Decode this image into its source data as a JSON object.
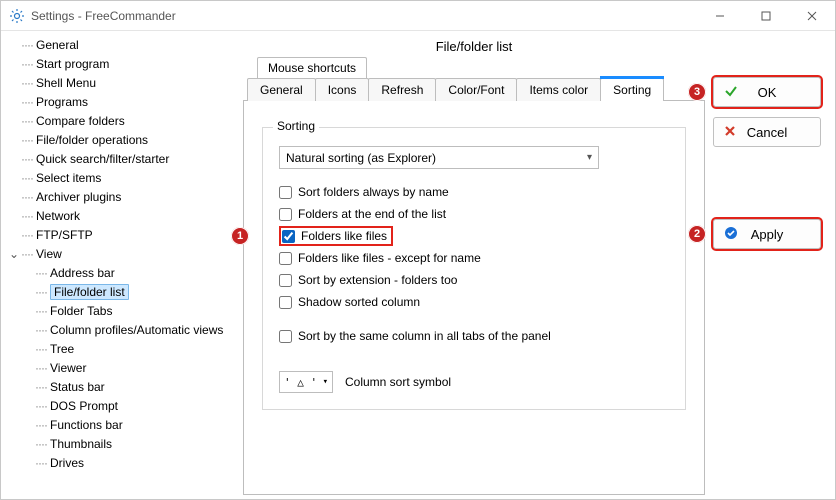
{
  "window": {
    "title": "Settings - FreeCommander"
  },
  "sidebar": {
    "items": [
      {
        "label": "General",
        "level": 0
      },
      {
        "label": "Start program",
        "level": 0
      },
      {
        "label": "Shell Menu",
        "level": 0
      },
      {
        "label": "Programs",
        "level": 0
      },
      {
        "label": "Compare folders",
        "level": 0
      },
      {
        "label": "File/folder operations",
        "level": 0
      },
      {
        "label": "Quick search/filter/starter",
        "level": 0
      },
      {
        "label": "Select items",
        "level": 0
      },
      {
        "label": "Archiver plugins",
        "level": 0
      },
      {
        "label": "Network",
        "level": 0
      },
      {
        "label": "FTP/SFTP",
        "level": 0
      },
      {
        "label": "View",
        "level": 0,
        "expanded": true
      },
      {
        "label": "Address bar",
        "level": 1
      },
      {
        "label": "File/folder list",
        "level": 1,
        "selected": true
      },
      {
        "label": "Folder Tabs",
        "level": 1
      },
      {
        "label": "Column profiles/Automatic views",
        "level": 1
      },
      {
        "label": "Tree",
        "level": 1
      },
      {
        "label": "Viewer",
        "level": 1
      },
      {
        "label": "Status bar",
        "level": 1
      },
      {
        "label": "DOS Prompt",
        "level": 1
      },
      {
        "label": "Functions bar",
        "level": 1
      },
      {
        "label": "Thumbnails",
        "level": 1
      },
      {
        "label": "Drives",
        "level": 1
      }
    ]
  },
  "content": {
    "section_title": "File/folder list",
    "secondary_tabs": [
      "Mouse shortcuts"
    ],
    "tabs": [
      "General",
      "Icons",
      "Refresh",
      "Color/Font",
      "Items color",
      "Sorting"
    ],
    "active_tab": "Sorting",
    "sorting": {
      "group_title": "Sorting",
      "dropdown_value": "Natural sorting (as Explorer)",
      "checkboxes": [
        {
          "label": "Sort folders always by name",
          "checked": false
        },
        {
          "label": "Folders at the end of the list",
          "checked": false
        },
        {
          "label": "Folders like files",
          "checked": true,
          "highlight": true,
          "badge": "1"
        },
        {
          "label": "Folders like files - except for name",
          "checked": false
        },
        {
          "label": "Sort by extension - folders too",
          "checked": false
        },
        {
          "label": "Shadow sorted column",
          "checked": false
        }
      ],
      "same_column": {
        "label": "Sort by the same column in all tabs of the panel",
        "checked": false
      },
      "symbol": {
        "value": "' △ '",
        "label": "Column sort symbol"
      }
    }
  },
  "actions": {
    "ok": "OK",
    "cancel": "Cancel",
    "apply": "Apply",
    "badge_apply": "2",
    "badge_ok": "3"
  }
}
